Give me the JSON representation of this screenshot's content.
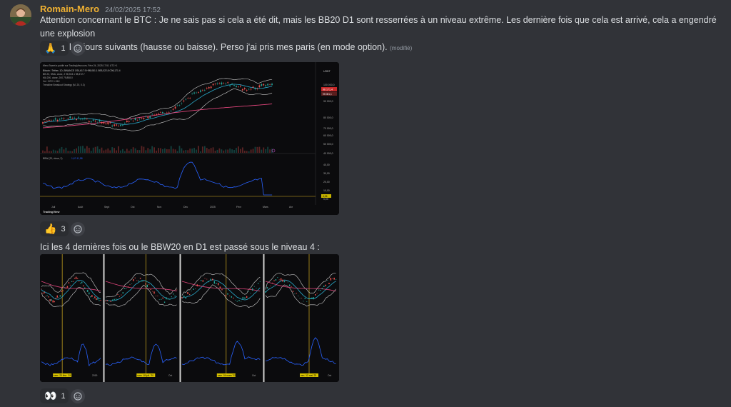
{
  "message1": {
    "username": "Romain-Mero",
    "timestamp": "24/02/2025 17:52",
    "text_line1": "Attention concernant le BTC : Je ne sais pas si cela a été dit, mais les BB20 D1 sont resserrées à un niveau extrême. Les dernière fois que cela est arrivé, cela a engendré une explosion",
    "text_line2": "du prix les jours suivants (hausse ou baisse). Perso j'ai pris mes paris (en mode option).",
    "edited_label": "(modifié)",
    "reaction": {
      "emoji": "🙏",
      "count": "1"
    },
    "chart": {
      "header": "Mero Sweet a publié sur TradingView.com, Févr 24, 2025 17:51 UTC+1",
      "symbol_line": "Bitcoin / Tether, 1D, BINANCE  O91,617.9  H95,081.1  B93,022.8  C96,171.4",
      "bb_line": "BB 20, SMA, close, 2  96,943.1  98,372.7",
      "ma_line": "MA 200, close, 200  79,858.0",
      "vol_line": "Vol · BTC  1.31K",
      "strategy_line": "Trendline Breakout Strategy (M, 20, 0.3)",
      "currency": "USDT",
      "price_axis": [
        "100 000,0",
        "90 000,0",
        "80 000,0",
        "70 000,0",
        "60 000,0",
        "50 000,0",
        "40 000,0"
      ],
      "price_tag": "96 171,4",
      "price_tag2": "95 081,1",
      "indicator_label": "BBW (20, close, 2)",
      "indicator_value": "1,67  41,58",
      "indicator_axis": [
        "40,00",
        "30,00",
        "20,00",
        "10,00",
        "0,00"
      ],
      "indicator_tag": "4,06",
      "months": [
        "Juil",
        "Août",
        "Sept",
        "Oct",
        "Nov",
        "Déc",
        "2025",
        "Févr",
        "Mars",
        "Avr"
      ],
      "brand": "TradingView"
    },
    "reaction2": {
      "emoji": "👍",
      "count": "3"
    }
  },
  "message2": {
    "text": "Ici les 4 dernières fois ou le BBW20 en D1 est passé sous le niveau 4 :",
    "panels": [
      {
        "date_tag": "sam. 23 févr. '19",
        "tick": "2019"
      },
      {
        "date_tag": "sam. 18 juil. '20",
        "tick": "Oct"
      },
      {
        "date_tag": "sam. 04 mars '22",
        "tick": "Oct"
      },
      {
        "date_tag": "ven. 12 mai '23",
        "tick": "Oct"
      }
    ],
    "reaction": {
      "emoji": "👀",
      "count": "1"
    }
  },
  "colors": {
    "background": "#313338",
    "username": "#f0b132",
    "reaction_bg": "#2b2d31",
    "up_candle": "#26a69a",
    "down_candle": "#ef5350",
    "ma200": "#e0457b",
    "bb_basis": "#2aa8c9",
    "bbw_line": "#2962ff",
    "vertical_marker": "#d7b020"
  }
}
